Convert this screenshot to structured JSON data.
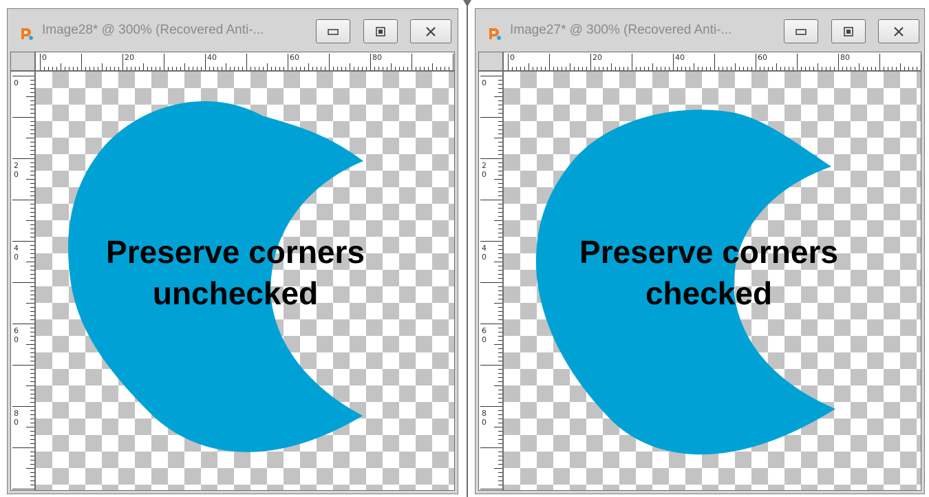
{
  "colors": {
    "shape_fill": "#00a2d6",
    "checker_dark": "#c3c3c3",
    "checker_light": "#ffffff",
    "window_bg": "#d5d5d5",
    "title_text": "#8a8a8a"
  },
  "icons": {
    "app": "paintshop-pro-icon",
    "minimize": "minimize-icon",
    "maximize": "maximize-icon",
    "close": "close-icon"
  },
  "windows": [
    {
      "title": "Image28* @ 300% (Recovered Anti-...",
      "caption_line1": "Preserve corners",
      "caption_line2": "unchecked"
    },
    {
      "title": "Image27* @ 300% (Recovered Anti-...",
      "caption_line1": "Preserve corners",
      "caption_line2": "checked"
    }
  ],
  "ruler": {
    "top_labels": [
      "0",
      "20",
      "40",
      "60",
      "80"
    ],
    "left_labels": [
      [
        "0"
      ],
      [
        "2",
        "0"
      ],
      [
        "4",
        "0"
      ],
      [
        "6",
        "0"
      ],
      [
        "8",
        "0"
      ]
    ]
  }
}
